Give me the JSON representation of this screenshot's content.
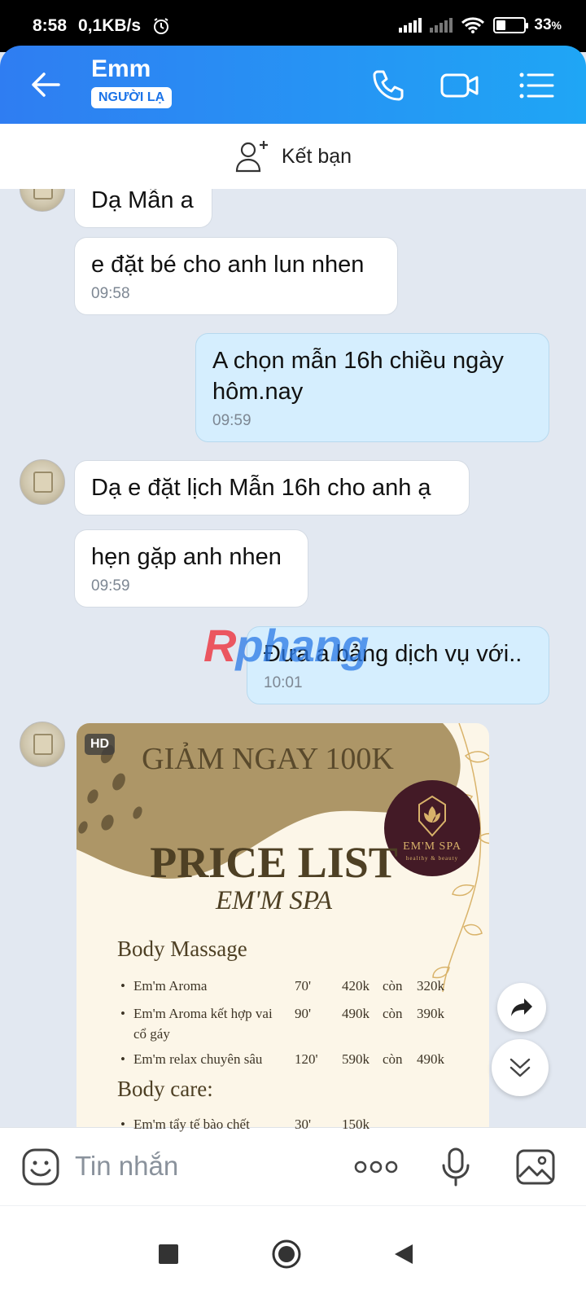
{
  "status_bar": {
    "time": "8:58",
    "network_speed": "0,1KB/s",
    "battery_percent": "33",
    "battery_level": 0.33
  },
  "header": {
    "contact_name": "Emm",
    "stranger_badge": "NGƯỜI LẠ"
  },
  "add_friend": {
    "label": "Kết bạn"
  },
  "messages": [
    {
      "direction": "incoming",
      "text": "Dạ Mẫn a",
      "time": ""
    },
    {
      "direction": "incoming",
      "text": "e đặt bé cho anh lun nhen",
      "time": "09:58"
    },
    {
      "direction": "outgoing",
      "text": "A chọn mẫn 16h chiều ngày hôm.nay",
      "time": "09:59"
    },
    {
      "direction": "incoming",
      "text": "Dạ e đặt lịch Mẫn 16h cho anh ạ",
      "time": ""
    },
    {
      "direction": "incoming",
      "text": "hẹn gặp anh nhen",
      "time": "09:59"
    },
    {
      "direction": "outgoing",
      "text": "Đưa a bảng dịch vụ với..",
      "time": "10:01"
    }
  ],
  "watermark": {
    "part1": "R",
    "part2": "phang"
  },
  "image_message": {
    "badge": "HD",
    "promo": "GIẢM NGAY 100K",
    "heading": "PRICE LIST",
    "subheading": "EM'M SPA",
    "logo_name": "EM'M SPA",
    "logo_tagline": "healthy & beauty",
    "sections": [
      {
        "title": "Body Massage",
        "items": [
          {
            "name": "Em'm Aroma",
            "duration": "70'",
            "old_price": "420k",
            "connector": "còn",
            "new_price": "320k"
          },
          {
            "name": "Em'm Aroma kết hợp vai cổ gáy",
            "duration": "90'",
            "old_price": "490k",
            "connector": "còn",
            "new_price": "390k"
          },
          {
            "name": "Em'm relax chuyên sâu",
            "duration": "120'",
            "old_price": "590k",
            "connector": "còn",
            "new_price": "490k"
          }
        ]
      },
      {
        "title": "Body care:",
        "items": [
          {
            "name": "Em'm tẩy tế bào chết",
            "duration": "30'",
            "old_price": "150k"
          }
        ]
      }
    ]
  },
  "input": {
    "placeholder": "Tin nhắn"
  },
  "icons": {
    "back": "arrow-left-icon",
    "call": "phone-icon",
    "video": "video-camera-icon",
    "menu": "list-menu-icon",
    "add_friend": "user-plus-icon",
    "share": "share-forward-icon",
    "scroll_down": "double-chevron-down-icon",
    "emoji": "emoji-icon",
    "more": "more-dots-icon",
    "mic": "microphone-icon",
    "gallery": "image-gallery-icon",
    "nav_recents": "square-icon",
    "nav_home": "circle-icon",
    "nav_back": "triangle-back-icon"
  },
  "colors": {
    "accent": "#2f7df2",
    "outgoing_bubble": "#d5eefe",
    "chat_background": "#e2e8f1"
  }
}
